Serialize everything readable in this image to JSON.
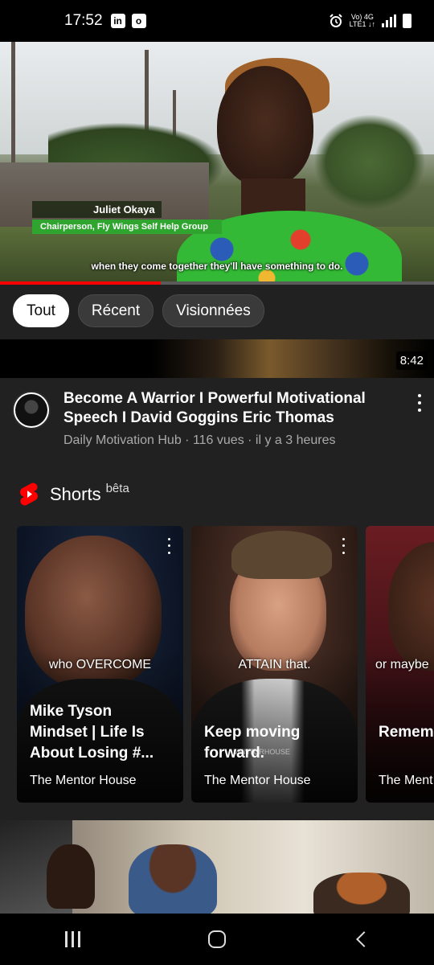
{
  "status_bar": {
    "time": "17:52",
    "app_icons": [
      "in",
      "o"
    ],
    "network_top": "Vo) 4G",
    "network_bottom": "LTE1 ↓↑",
    "icons": [
      "alarm-icon",
      "signal-icon",
      "battery-icon"
    ]
  },
  "player": {
    "lower_third_name": "Juliet Okaya",
    "lower_third_title": "Chairperson, Fly Wings Self Help Group",
    "caption": "when they come together they'll have something to do.",
    "progress": 0.37,
    "progress_color": "#ff0000"
  },
  "chips": [
    {
      "label": "Tout",
      "active": true
    },
    {
      "label": "Récent",
      "active": false
    },
    {
      "label": "Visionnées",
      "active": false
    }
  ],
  "video": {
    "duration": "8:42",
    "title": "Become A Warrior I Powerful Motivational Speech I  David Goggins Eric Thomas",
    "meta": "Daily Motivation Hub · 116 vues · il y a 3 heures"
  },
  "shorts": {
    "title": "Shorts",
    "beta": "bêta",
    "accent": "#ff0000",
    "items": [
      {
        "caption": "who OVERCOME",
        "title": "Mike Tyson Mindset | Life Is About Losing #...",
        "channel": "The Mentor House"
      },
      {
        "caption": "ATTAIN that.",
        "title": "Keep moving forward.",
        "channel": "The Mentor House",
        "watermark": "MENTORHOUSE"
      },
      {
        "caption": "or maybe",
        "title": "Remem... you rea...",
        "channel": "The Ment..."
      }
    ]
  },
  "nav": {
    "icons": [
      "recent-apps-icon",
      "home-icon",
      "back-icon"
    ]
  }
}
